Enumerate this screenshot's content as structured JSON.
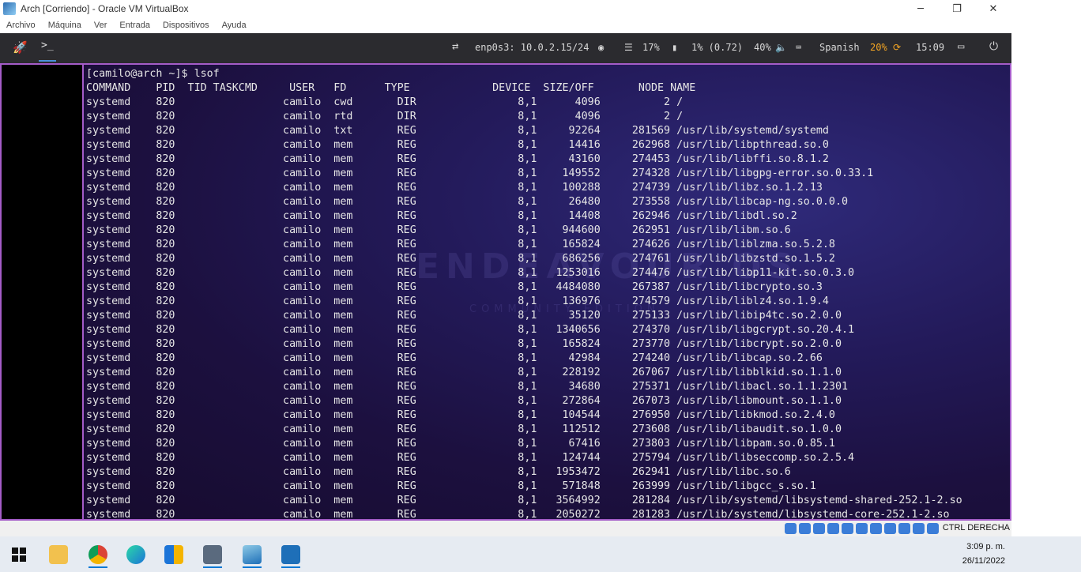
{
  "window": {
    "title": "Arch [Corriendo] - Oracle VM VirtualBox",
    "minimize": "─",
    "restore": "❐",
    "close": "✕"
  },
  "menubar": {
    "items": [
      "Archivo",
      "Máquina",
      "Ver",
      "Entrada",
      "Dispositivos",
      "Ayuda"
    ]
  },
  "guest_panel": {
    "rocket_icon": "🚀",
    "terminal_tab": ">_",
    "network_icon": "⇄",
    "network": "enp0s3: 10.0.2.15/24",
    "eye_icon": "◉",
    "cpu_icon": "☰",
    "cpu": "17%",
    "mem_icon": "▮",
    "load": "1% (0.72)",
    "volume": "40%",
    "volume_icon": "🔈",
    "keyboard_icon": "⌨",
    "layout": "Spanish",
    "battery": "20%",
    "refresh_icon": "⟳",
    "time": "15:09",
    "window_icon": "▭",
    "power_icon": "⏻"
  },
  "terminal": {
    "prompt": "[camilo@arch ~]$ lsof",
    "header": "COMMAND    PID  TID TASKCMD     USER   FD      TYPE             DEVICE  SIZE/OFF       NODE NAME",
    "rows": [
      "systemd    820                 camilo  cwd       DIR                8,1      4096          2 /",
      "systemd    820                 camilo  rtd       DIR                8,1      4096          2 /",
      "systemd    820                 camilo  txt       REG                8,1     92264     281569 /usr/lib/systemd/systemd",
      "systemd    820                 camilo  mem       REG                8,1     14416     262968 /usr/lib/libpthread.so.0",
      "systemd    820                 camilo  mem       REG                8,1     43160     274453 /usr/lib/libffi.so.8.1.2",
      "systemd    820                 camilo  mem       REG                8,1    149552     274328 /usr/lib/libgpg-error.so.0.33.1",
      "systemd    820                 camilo  mem       REG                8,1    100288     274739 /usr/lib/libz.so.1.2.13",
      "systemd    820                 camilo  mem       REG                8,1     26480     273558 /usr/lib/libcap-ng.so.0.0.0",
      "systemd    820                 camilo  mem       REG                8,1     14408     262946 /usr/lib/libdl.so.2",
      "systemd    820                 camilo  mem       REG                8,1    944600     262951 /usr/lib/libm.so.6",
      "systemd    820                 camilo  mem       REG                8,1    165824     274626 /usr/lib/liblzma.so.5.2.8",
      "systemd    820                 camilo  mem       REG                8,1    686256     274761 /usr/lib/libzstd.so.1.5.2",
      "systemd    820                 camilo  mem       REG                8,1   1253016     274476 /usr/lib/libp11-kit.so.0.3.0",
      "systemd    820                 camilo  mem       REG                8,1   4484080     267387 /usr/lib/libcrypto.so.3",
      "systemd    820                 camilo  mem       REG                8,1    136976     274579 /usr/lib/liblz4.so.1.9.4",
      "systemd    820                 camilo  mem       REG                8,1     35120     275133 /usr/lib/libip4tc.so.2.0.0",
      "systemd    820                 camilo  mem       REG                8,1   1340656     274370 /usr/lib/libgcrypt.so.20.4.1",
      "systemd    820                 camilo  mem       REG                8,1    165824     273770 /usr/lib/libcrypt.so.2.0.0",
      "systemd    820                 camilo  mem       REG                8,1     42984     274240 /usr/lib/libcap.so.2.66",
      "systemd    820                 camilo  mem       REG                8,1    228192     267067 /usr/lib/libblkid.so.1.1.0",
      "systemd    820                 camilo  mem       REG                8,1     34680     275371 /usr/lib/libacl.so.1.1.2301",
      "systemd    820                 camilo  mem       REG                8,1    272864     267073 /usr/lib/libmount.so.1.1.0",
      "systemd    820                 camilo  mem       REG                8,1    104544     276950 /usr/lib/libkmod.so.2.4.0",
      "systemd    820                 camilo  mem       REG                8,1    112512     273608 /usr/lib/libaudit.so.1.0.0",
      "systemd    820                 camilo  mem       REG                8,1     67416     273803 /usr/lib/libpam.so.0.85.1",
      "systemd    820                 camilo  mem       REG                8,1    124744     275794 /usr/lib/libseccomp.so.2.5.4",
      "systemd    820                 camilo  mem       REG                8,1   1953472     262941 /usr/lib/libc.so.6",
      "systemd    820                 camilo  mem       REG                8,1    571848     263999 /usr/lib/libgcc_s.so.1",
      "systemd    820                 camilo  mem       REG                8,1   3564992     281284 /usr/lib/systemd/libsystemd-shared-252.1-2.so",
      "systemd    820                 camilo  mem       REG                8,1   2050272     281283 /usr/lib/systemd/libsystemd-core-252.1-2.so"
    ],
    "watermark": "ENDEAVOUR OS",
    "watermark_sub": "COMMUNITY EDITION"
  },
  "vbox_status": {
    "host_key": "CTRL DERECHA"
  },
  "taskbar": {
    "apps": [
      "start",
      "file-explorer",
      "chrome",
      "edge",
      "sticky-notes",
      "virtualbox-app",
      "photos-app",
      "media-player"
    ],
    "time": "3:09 p. m.",
    "date": "26/11/2022"
  },
  "colors": {
    "accent_purple": "#a45cc8",
    "accent_orange": "#f5a623",
    "terminal_text": "#e6e6e6"
  }
}
